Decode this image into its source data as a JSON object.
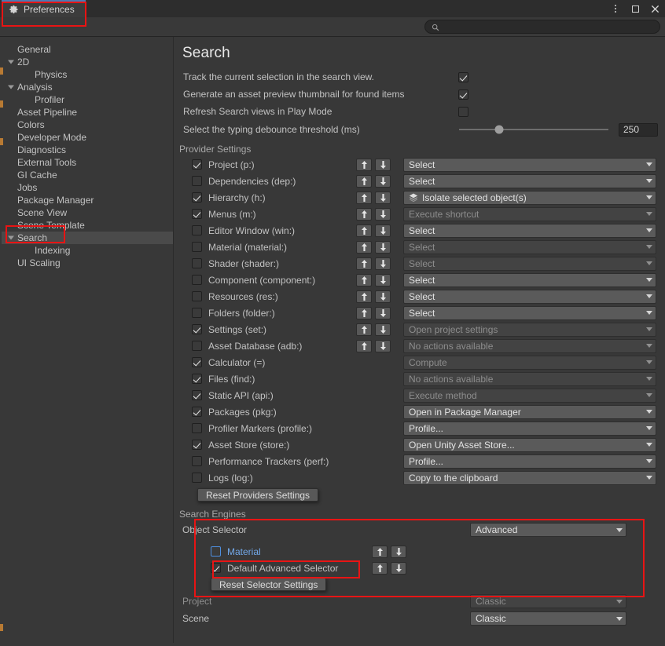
{
  "window": {
    "tab_label": "Preferences",
    "gear_icon": "gear-icon",
    "menu_icon": "kebab-menu-icon",
    "maximize_icon": "maximize-icon",
    "close_icon": "close-icon"
  },
  "search_toolbar": {
    "icon": "magnifier-icon",
    "value": "",
    "placeholder": ""
  },
  "sidebar": {
    "items": [
      {
        "label": "General",
        "indent": 0,
        "arrow": false,
        "selected": false
      },
      {
        "label": "2D",
        "indent": 0,
        "arrow": true,
        "selected": false
      },
      {
        "label": "Physics",
        "indent": 1,
        "arrow": false,
        "selected": false
      },
      {
        "label": "Analysis",
        "indent": 0,
        "arrow": true,
        "selected": false
      },
      {
        "label": "Profiler",
        "indent": 1,
        "arrow": false,
        "selected": false
      },
      {
        "label": "Asset Pipeline",
        "indent": 0,
        "arrow": false,
        "selected": false
      },
      {
        "label": "Colors",
        "indent": 0,
        "arrow": false,
        "selected": false
      },
      {
        "label": "Developer Mode",
        "indent": 0,
        "arrow": false,
        "selected": false
      },
      {
        "label": "Diagnostics",
        "indent": 0,
        "arrow": false,
        "selected": false
      },
      {
        "label": "External Tools",
        "indent": 0,
        "arrow": false,
        "selected": false
      },
      {
        "label": "GI Cache",
        "indent": 0,
        "arrow": false,
        "selected": false
      },
      {
        "label": "Jobs",
        "indent": 0,
        "arrow": false,
        "selected": false
      },
      {
        "label": "Package Manager",
        "indent": 0,
        "arrow": false,
        "selected": false
      },
      {
        "label": "Scene View",
        "indent": 0,
        "arrow": false,
        "selected": false
      },
      {
        "label": "Scene Template",
        "indent": 0,
        "arrow": false,
        "selected": false
      },
      {
        "label": "Search",
        "indent": 0,
        "arrow": true,
        "selected": true
      },
      {
        "label": "Indexing",
        "indent": 1,
        "arrow": false,
        "selected": false
      },
      {
        "label": "UI Scaling",
        "indent": 0,
        "arrow": false,
        "selected": false
      }
    ]
  },
  "page": {
    "title": "Search",
    "options": [
      {
        "label": "Track the current selection in the search view.",
        "checked": true
      },
      {
        "label": "Generate an asset preview thumbnail for found items",
        "checked": true
      },
      {
        "label": "Refresh Search views in Play Mode",
        "checked": false
      }
    ],
    "debounce": {
      "label": "Select the typing debounce threshold (ms)",
      "value": "250",
      "slider_percent": 27,
      "min": 0,
      "max": 1000
    }
  },
  "provider_settings": {
    "title": "Provider Settings",
    "reset_button": "Reset Providers Settings",
    "rows": [
      {
        "name": "Project (p:)",
        "checked": true,
        "arrows": true,
        "action": "Select",
        "action_dim": false,
        "action_icon": null
      },
      {
        "name": "Dependencies (dep:)",
        "checked": false,
        "arrows": true,
        "action": "Select",
        "action_dim": false,
        "action_icon": null
      },
      {
        "name": "Hierarchy (h:)",
        "checked": true,
        "arrows": true,
        "action": "Isolate selected object(s)",
        "action_dim": false,
        "action_icon": "isolate-icon"
      },
      {
        "name": "Menus (m:)",
        "checked": true,
        "arrows": true,
        "action": "Execute shortcut",
        "action_dim": true,
        "action_icon": null
      },
      {
        "name": "Editor Window (win:)",
        "checked": false,
        "arrows": true,
        "action": "Select",
        "action_dim": false,
        "action_icon": null
      },
      {
        "name": "Material (material:)",
        "checked": false,
        "arrows": true,
        "action": "Select",
        "action_dim": true,
        "action_icon": null
      },
      {
        "name": "Shader (shader:)",
        "checked": false,
        "arrows": true,
        "action": "Select",
        "action_dim": true,
        "action_icon": null
      },
      {
        "name": "Component (component:)",
        "checked": false,
        "arrows": true,
        "action": "Select",
        "action_dim": false,
        "action_icon": null
      },
      {
        "name": "Resources (res:)",
        "checked": false,
        "arrows": true,
        "action": "Select",
        "action_dim": false,
        "action_icon": null
      },
      {
        "name": "Folders (folder:)",
        "checked": false,
        "arrows": true,
        "action": "Select",
        "action_dim": false,
        "action_icon": null
      },
      {
        "name": "Settings (set:)",
        "checked": true,
        "arrows": true,
        "action": "Open project settings",
        "action_dim": true,
        "action_icon": null
      },
      {
        "name": "Asset Database (adb:)",
        "checked": false,
        "arrows": true,
        "action": "No actions available",
        "action_dim": true,
        "action_icon": null
      },
      {
        "name": "Calculator (=)",
        "checked": true,
        "arrows": false,
        "action": "Compute",
        "action_dim": true,
        "action_icon": null
      },
      {
        "name": "Files (find:)",
        "checked": true,
        "arrows": false,
        "action": "No actions available",
        "action_dim": true,
        "action_icon": null
      },
      {
        "name": "Static API (api:)",
        "checked": true,
        "arrows": false,
        "action": "Execute method",
        "action_dim": true,
        "action_icon": null
      },
      {
        "name": "Packages (pkg:)",
        "checked": true,
        "arrows": false,
        "action": "Open in Package Manager",
        "action_dim": false,
        "action_icon": null
      },
      {
        "name": "Profiler Markers (profile:)",
        "checked": false,
        "arrows": false,
        "action": "Profile...",
        "action_dim": false,
        "action_icon": null
      },
      {
        "name": "Asset Store (store:)",
        "checked": true,
        "arrows": false,
        "action": "Open Unity Asset Store...",
        "action_dim": false,
        "action_icon": null
      },
      {
        "name": "Performance Trackers (perf:)",
        "checked": false,
        "arrows": false,
        "action": "Profile...",
        "action_dim": false,
        "action_icon": null
      },
      {
        "name": "Logs (log:)",
        "checked": false,
        "arrows": false,
        "action": "Copy to the clipboard",
        "action_dim": false,
        "action_icon": null
      }
    ]
  },
  "search_engines": {
    "title": "Search Engines",
    "object_selector": {
      "label": "Object Selector",
      "value": "Advanced"
    },
    "engines": [
      {
        "label": "Material",
        "checked": false,
        "blue": true
      },
      {
        "label": "Default Advanced Selector",
        "checked": true,
        "blue": false
      }
    ],
    "reset_button": "Reset Selector Settings",
    "project": {
      "label": "Project",
      "value": "Classic"
    },
    "scene": {
      "label": "Scene",
      "value": "Classic"
    }
  },
  "highlights": {
    "accent_color": "#e81414",
    "boxes": [
      "preferences-tab",
      "sidebar-search-item",
      "search-engines-block",
      "default-advanced-selector-row"
    ]
  }
}
